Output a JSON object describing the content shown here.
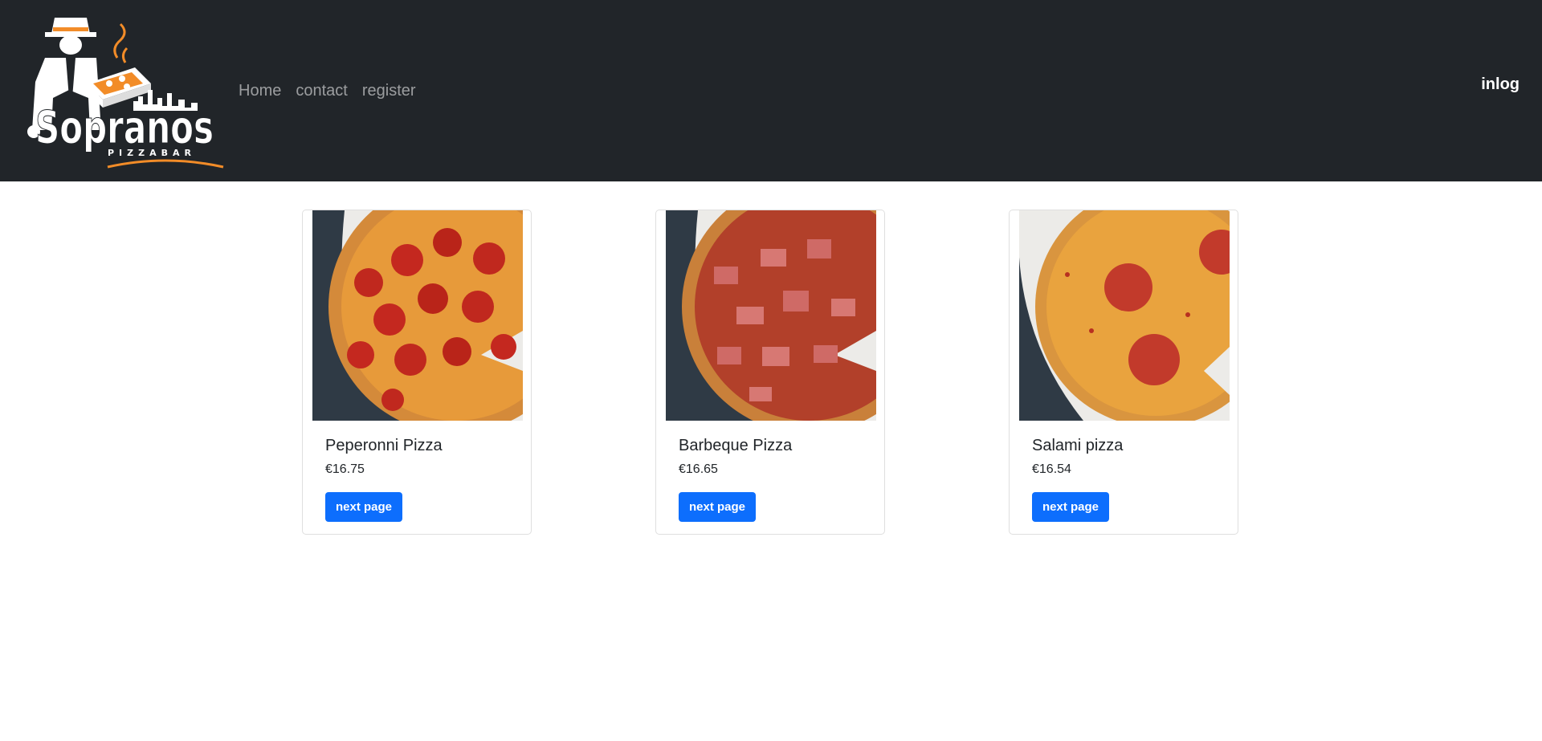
{
  "brand": {
    "logo_text": "Sopranos",
    "logo_subtext": "PIZZABAR",
    "accent_color": "#f28c28"
  },
  "nav": {
    "items": [
      {
        "label": "Home"
      },
      {
        "label": "contact"
      },
      {
        "label": "register"
      }
    ],
    "login_label": "inlog"
  },
  "products": [
    {
      "name": "Peperonni Pizza",
      "price": "€16.75",
      "button_label": "next page",
      "image": "pepperoni-pizza-photo"
    },
    {
      "name": "Barbeque Pizza",
      "price": "€16.65",
      "button_label": "next page",
      "image": "bbq-pizza-photo"
    },
    {
      "name": "Salami pizza",
      "price": "€16.54",
      "button_label": "next page",
      "image": "salami-pizza-photo"
    }
  ],
  "colors": {
    "navbar_bg": "#212529",
    "button_bg": "#0d6efd"
  }
}
